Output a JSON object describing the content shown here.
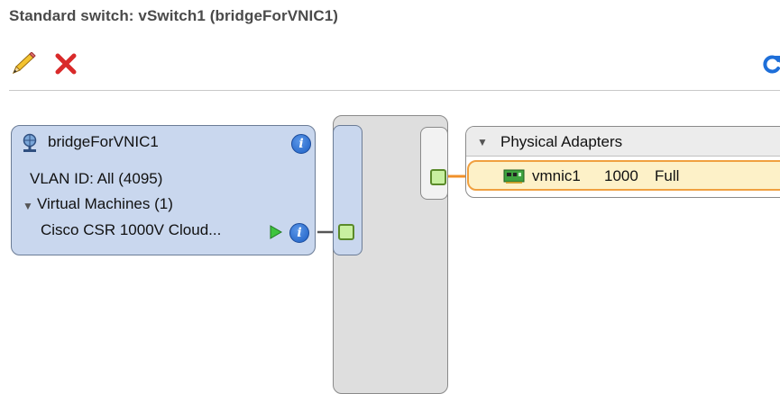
{
  "header": {
    "title": "Standard switch: vSwitch1 (bridgeForVNIC1)"
  },
  "toolbar": {
    "edit_icon": "pencil-icon",
    "remove_icon": "red-x-icon",
    "refresh_icon": "refresh-icon"
  },
  "port_group": {
    "name": "bridgeForVNIC1",
    "vlan": "VLAN ID: All (4095)",
    "vms_header": "Virtual Machines (1)",
    "vm_name": "Cisco CSR 1000V Cloud..."
  },
  "physical_adapters": {
    "header": "Physical Adapters",
    "adapter_name": "vmnic1",
    "speed": "1000",
    "duplex": "Full"
  },
  "colors": {
    "link_orange": "#f0902a",
    "portgroup_bg": "#c9d7ee",
    "switch_bg": "#dcdcdc",
    "adapter_bg": "#fdf1c8"
  }
}
